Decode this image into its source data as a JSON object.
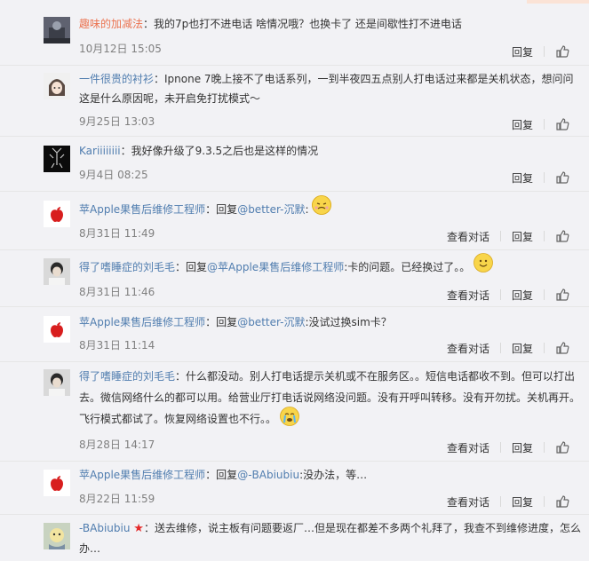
{
  "comments": [
    {
      "user": "趣味的加减法",
      "text": "：我的7p也打不进电话 啥情况哦？也换卡了 还是间歇性打不进电话",
      "time": "10月12日 15:05",
      "reply_label": "回复"
    },
    {
      "user": "一件很贵的衬衫",
      "text": "：Ipnone 7晚上接不了电话系列，一到半夜四五点别人打电话过来都是关机状态，想问问这是什么原因呢，未开启免打扰模式～",
      "time": "9月25日 13:03",
      "reply_label": "回复"
    },
    {
      "user": "Kariiiiiiii",
      "text": "：我好像升级了9.3.5之后也是这样的情况",
      "time": "9月4日 08:25",
      "reply_label": "回复"
    },
    {
      "user": "苹Apple果售后维修工程师",
      "prefix": "：回复",
      "mention": "@better-沉默",
      "suffix": ":",
      "time": "8月31日 11:49",
      "conversation_label": "查看对话",
      "reply_label": "回复"
    },
    {
      "user": "得了嗜睡症的刘毛毛",
      "prefix": "：回复",
      "mention": "@苹Apple果售后维修工程师",
      "suffix": ":卡的问题。已经换过了。。",
      "time": "8月31日 11:46",
      "conversation_label": "查看对话",
      "reply_label": "回复"
    },
    {
      "user": "苹Apple果售后维修工程师",
      "prefix": "：回复",
      "mention": "@better-沉默",
      "suffix": ":没试过换sim卡？",
      "time": "8月31日 11:14",
      "conversation_label": "查看对话",
      "reply_label": "回复"
    },
    {
      "user": "得了嗜睡症的刘毛毛",
      "text": "：什么都没动。别人打电话提示关机或不在服务区。。短信电话都收不到。但可以打出去。微信网络什么的都可以用。给营业厅打电话说网络没问题。没有开呼叫转移。没有开勿扰。关机再开。飞行模式都试了。恢复网络设置也不行。。",
      "time": "8月28日 14:17",
      "conversation_label": "查看对话",
      "reply_label": "回复"
    },
    {
      "user": "苹Apple果售后维修工程师",
      "prefix": "：回复",
      "mention": "@-BAbiubiu",
      "suffix": ":没办法，等…",
      "time": "8月22日 11:59",
      "conversation_label": "查看对话",
      "reply_label": "回复"
    },
    {
      "user": "-BAbiubiu",
      "text": "：送去维修，说主板有问题要返厂…但是现在都差不多两个礼拜了，我查不到维修进度，怎么办…"
    }
  ],
  "icons": {
    "like": "thumbs-up-icon",
    "star": "red-star-icon",
    "apple": "apple-logo-icon"
  },
  "colors": {
    "username_orange": "#eb7350",
    "username_blue": "#507daf",
    "time_gray": "#808080"
  }
}
